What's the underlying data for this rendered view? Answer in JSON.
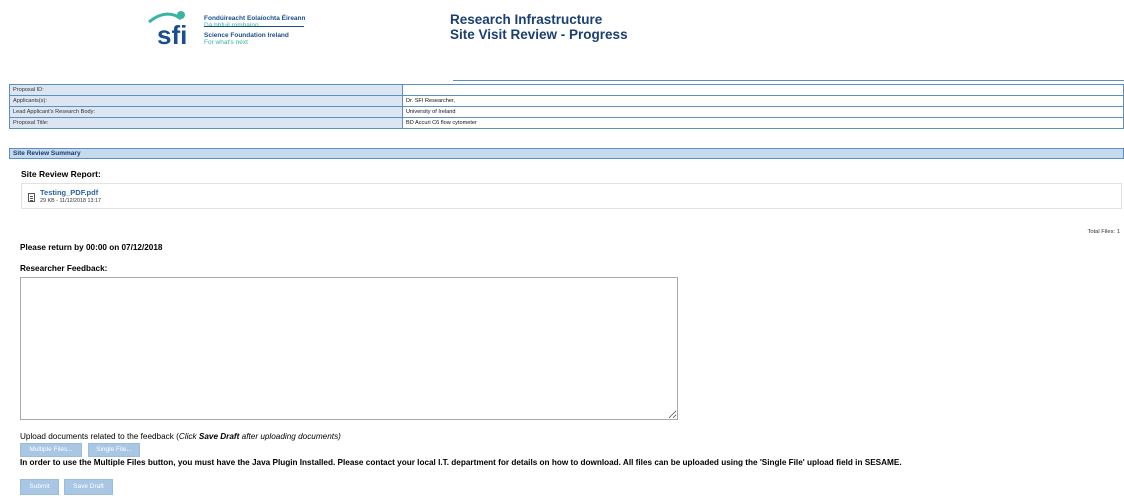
{
  "header": {
    "logo": {
      "irish_name": "Fondúireacht Eolaíochta Éireann",
      "irish_tagline": "Dá bhfuil romhainn",
      "english_name": "Science Foundation Ireland",
      "english_tagline": "For what's next",
      "mark": "sfi",
      "colors": {
        "navy": "#1a4f8b",
        "teal": "#39b4a0"
      }
    },
    "title_line1": "Research Infrastructure",
    "title_line2": "Site Visit Review - Progress"
  },
  "info_table": [
    {
      "label": "Proposal ID:",
      "value": ""
    },
    {
      "label": "Applicants(s):",
      "value": "Dr. SFI Researcher,"
    },
    {
      "label": "Lead Applicant's Research Body:",
      "value": "University of Ireland"
    },
    {
      "label": "Proposal Title:",
      "value": "BD Accuri C6 flow cytometer"
    }
  ],
  "summary": {
    "section_title": "Site Review Summary",
    "report_label": "Site Review Report:",
    "file": {
      "icon": "document-icon",
      "name": "Testing_PDF.pdf",
      "meta": "29 KB - 11/12/2018 13:17"
    },
    "total_files": "Total Files: 1"
  },
  "feedback": {
    "return_by": "Please return by 00:00 on 07/12/2018",
    "label": "Researcher Feedback:",
    "value": "",
    "upload_note_prefix": "Upload documents related to the feedback (",
    "upload_note_click": "Click ",
    "upload_note_save": "Save Draft",
    "upload_note_suffix": " after uploading documents)",
    "multiple_files_label": "Multiple Files...",
    "single_file_label": "Single File...",
    "java_note": "In order to use the Multiple Files button, you must have the Java Plugin Installed. Please contact your local I.T. department for details on how to download. All files can be uploaded using the 'Single File' upload field in SESAME."
  },
  "actions": {
    "submit_label": "Submit",
    "save_draft_label": "Save Draft"
  },
  "colors": {
    "border_blue": "#5d8fc7",
    "label_bg": "#dce6f2",
    "section_bg": "#c5d9ef",
    "button_bg": "#a9c6e4",
    "title": "#1a3f73",
    "link": "#2a63a8"
  }
}
